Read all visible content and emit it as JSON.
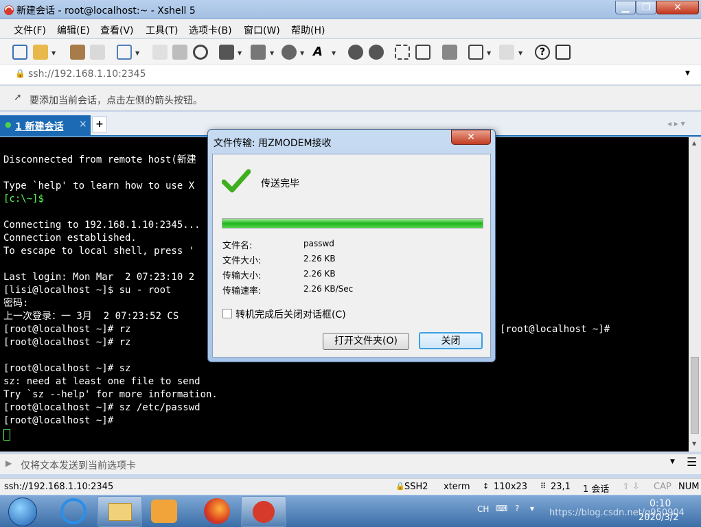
{
  "window": {
    "title": "新建会话 - root@localhost:~ - Xshell 5",
    "min": "▁",
    "max": "❐",
    "close": "✕"
  },
  "menu": [
    "文件(F)",
    "编辑(E)",
    "查看(V)",
    "工具(T)",
    "选项卡(B)",
    "窗口(W)",
    "帮助(H)"
  ],
  "address": {
    "value": "ssh://192.168.1.10:2345"
  },
  "hint": "要添加当前会话，点击左侧的箭头按钮。",
  "tabs": {
    "active": "1 新建会话",
    "close": "×",
    "add": "+",
    "nav": "◂ ▸ ▾"
  },
  "terminal": {
    "lines": [
      "",
      "Disconnected from remote host(新建",
      "",
      "Type `help' to learn how to use X",
      "[c:\\~]$",
      "",
      "Connecting to 192.168.1.10:2345...",
      "Connection established.",
      "To escape to local shell, press '",
      "",
      "Last login: Mon Mar  2 07:23:10 2",
      "[lisi@localhost ~]$ su - root",
      "密码:",
      "上一次登录：一 3月  2 07:23:52 CS",
      "[root@localhost ~]# rz",
      "[root@localhost ~]# rz",
      "",
      "[root@localhost ~]# sz",
      "sz: need at least one file to send",
      "Try `sz --help' for more information.",
      "[root@localhost ~]# sz /etc/passwd",
      "[root@localhost ~]#"
    ],
    "right_fragment": "[root@localhost ~]#"
  },
  "dialog": {
    "title": "文件传输: 用ZMODEM接收",
    "status": "传送完毕",
    "progress": 1.0,
    "fields": [
      {
        "label": "文件名:",
        "value": "passwd"
      },
      {
        "label": "文件大小:",
        "value": "2.26 KB"
      },
      {
        "label": "传输大小:",
        "value": "2.26 KB"
      },
      {
        "label": "传输速率:",
        "value": "2.26 KB/Sec"
      }
    ],
    "checkbox": "转机完成后关闭对话框(C)",
    "open_folder": "打开文件夹(O)",
    "close_btn": "关闭",
    "close_x": "✕"
  },
  "sendbar": "仅将文本发送到当前选项卡",
  "status": {
    "address": "ssh://192.168.1.10:2345",
    "protocol": "SSH2",
    "term": "xterm",
    "size": "110x23",
    "cursor": "23,1",
    "sessions": "1 会话",
    "cap": "CAP",
    "num": "NUM"
  },
  "taskbar": {
    "ime": "CH",
    "time": "0:10",
    "date": "2020/3/2",
    "watermark": "https://blog.csdn.net/g950904"
  },
  "colors": {
    "accent": "#1b6ab3",
    "prompt_green": "#55ff55",
    "progress": "#22c51f"
  }
}
